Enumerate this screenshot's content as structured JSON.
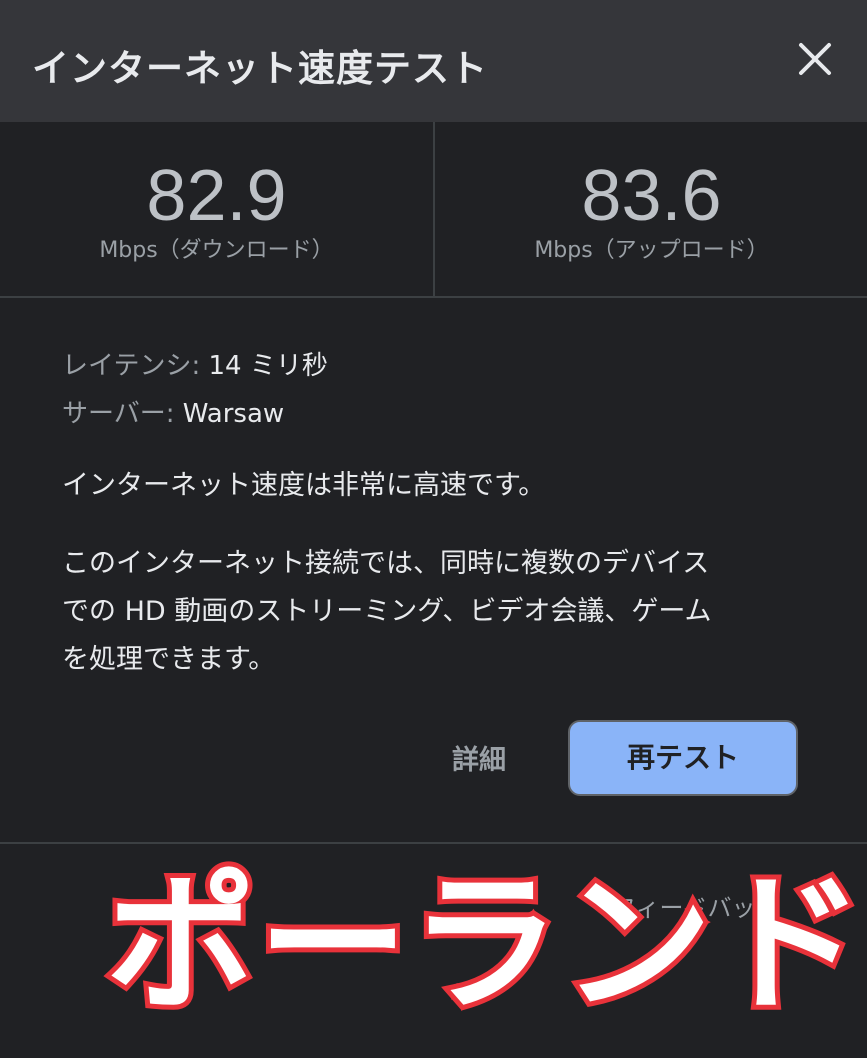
{
  "header": {
    "title": "インターネット速度テスト",
    "close_icon": "close-icon"
  },
  "metrics": {
    "download": {
      "value": "82.9",
      "label": "Mbps（ダウンロード）"
    },
    "upload": {
      "value": "83.6",
      "label": "Mbps（アップロード）"
    }
  },
  "details": {
    "latency_key": "レイテンシ:",
    "latency_value": "14 ミリ秒",
    "server_key": "サーバー:",
    "server_value": "Warsaw"
  },
  "summary": "インターネット速度は非常に高速です。",
  "description": {
    "line1": "このインターネット接続では、同時に複数のデバイス",
    "line2": "での HD 動画のストリーミング、ビデオ会議、ゲーム",
    "line3": "を処理できます。"
  },
  "actions": {
    "details_label": "詳細",
    "retest_label": "再テスト"
  },
  "footer": {
    "feedback_label": "フィードバック"
  },
  "overlay": {
    "caption": "ポーランド"
  },
  "colors": {
    "background": "#202124",
    "header_bg": "#35363a",
    "accent_button": "#8ab4f8",
    "caption_stroke": "#e8323a"
  }
}
